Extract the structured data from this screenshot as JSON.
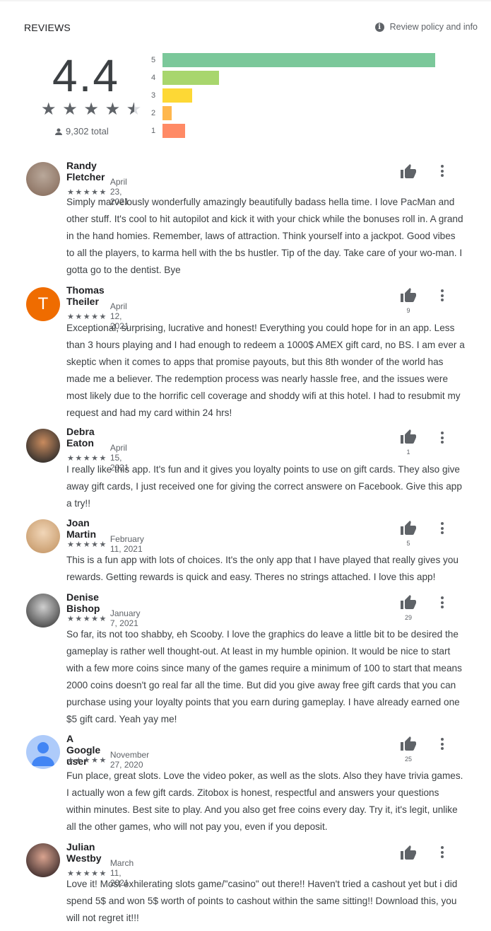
{
  "header": {
    "title": "REVIEWS",
    "policy_label": "Review policy and info",
    "policy_icon": "info-icon"
  },
  "summary": {
    "rating": "4.4",
    "stars": 4.5,
    "total": "9,302 total",
    "distribution": [
      {
        "label": "5",
        "fraction": 0.92,
        "color": "#7bc89a"
      },
      {
        "label": "4",
        "fraction": 0.19,
        "color": "#a8d66d"
      },
      {
        "label": "3",
        "fraction": 0.1,
        "color": "#fdd835"
      },
      {
        "label": "2",
        "fraction": 0.03,
        "color": "#ffb74d"
      },
      {
        "label": "1",
        "fraction": 0.075,
        "color": "#ff8a65"
      }
    ]
  },
  "reviews": [
    {
      "name": "Randy Fletcher",
      "date": "April 23, 2021",
      "rating": 5,
      "helpful": "",
      "avatar": {
        "type": "photo",
        "colors": [
          "#8a7060",
          "#b9a89a"
        ]
      },
      "text": "Simply marvelously wonderfully amazingly beautifully badass hella time. I love PacMan and other stuff. It's cool to hit autopilot and kick it with your chick while the bonuses roll in. A grand in the hand homies. Remember, laws of attraction. Think yourself into a jackpot. Good vibes to all the players, to karma hell with the bs hustler. Tip of the day. Take care of your wo-man. I gotta go to the dentist. Bye"
    },
    {
      "name": "Thomas Theiler",
      "date": "April 12, 2021",
      "rating": 5,
      "helpful": "9",
      "avatar": {
        "type": "letter",
        "letter": "T",
        "color": "#ef6c00"
      },
      "text": "Exceptional, surprising, lucrative and honest! Everything you could hope for in an app. Less than 3 hours playing and I had enough to redeem a 1000$ AMEX gift card, no BS. I am ever a skeptic when it comes to apps that promise payouts, but this 8th wonder of the world has made me a believer. The redemption process was nearly hassle free, and the issues were most likely due to the horrific cell coverage and shoddy wifi at this hotel. I had to resubmit my request and had my card within 24 hrs!"
    },
    {
      "name": "Debra Eaton",
      "date": "April 15, 2021",
      "rating": 5,
      "helpful": "1",
      "avatar": {
        "type": "photo",
        "colors": [
          "#2a2a2a",
          "#c98b5e"
        ]
      },
      "text": "I really like this app. It's fun and it gives you loyalty points to use on gift cards. They also give away gift cards, I just received one for giving the correct answere on Facebook. Give this app a try!!"
    },
    {
      "name": "Joan Martin",
      "date": "February 11, 2021",
      "rating": 5,
      "helpful": "5",
      "avatar": {
        "type": "photo",
        "colors": [
          "#c79a6a",
          "#f1d6b8"
        ]
      },
      "text": "This is a fun app with lots of choices. It's the only app that I have played that really gives you rewards. Getting rewards is quick and easy. Theres no strings attached. I love this app!"
    },
    {
      "name": "Denise Bishop",
      "date": "January 7, 2021",
      "rating": 5,
      "helpful": "29",
      "avatar": {
        "type": "photo",
        "colors": [
          "#444444",
          "#cfcfcf"
        ]
      },
      "text": "So far, its not too shabby, eh Scooby. I love the graphics do leave a little bit to be desired the gameplay is rather well thought-out. At least in my humble opinion. It would be nice to start with a few more coins since many of the games require a minimum of 100 to start that means 2000 coins doesn't go real far all the time. But did you give away free gift cards that you can purchase using your loyalty points that you earn during gameplay. I have already earned one $5 gift card. Yeah yay me!"
    },
    {
      "name": "A Google user",
      "date": "November 27, 2020",
      "rating": 5,
      "helpful": "25",
      "avatar": {
        "type": "default",
        "color": "#aecbfa",
        "fg": "#4285f4"
      },
      "text": "Fun place, great slots. Love the video poker, as well as the slots. Also they have trivia games. I actually won a few gift cards. Zitobox is honest, respectful and answers your questions within minutes. Best site to play. And you also get free coins every day. Try it, it's legit, unlike all the other games, who will not pay you, even if you deposit."
    },
    {
      "name": "Julian Westby",
      "date": "March 11, 2021",
      "rating": 5,
      "helpful": "",
      "avatar": {
        "type": "photo",
        "colors": [
          "#3a2a2a",
          "#d9a38f"
        ]
      },
      "text": "Love it! Most exhilerating slots game/\"casino\" out there!! Haven't tried a cashout yet but i did spend 5$ and won 5$ worth of points to cashout within the same sitting!! Download this, you will not regret it!!!"
    }
  ]
}
